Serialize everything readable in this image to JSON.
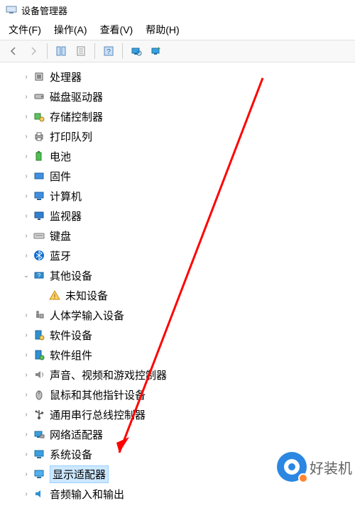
{
  "window": {
    "title": "设备管理器"
  },
  "menu": {
    "file": "文件(F)",
    "action": "操作(A)",
    "view": "查看(V)",
    "help": "帮助(H)"
  },
  "tree": {
    "items": [
      {
        "label": "处理器",
        "icon": "cpu",
        "expander": "›"
      },
      {
        "label": "磁盘驱动器",
        "icon": "disk",
        "expander": "›"
      },
      {
        "label": "存储控制器",
        "icon": "storage",
        "expander": "›"
      },
      {
        "label": "打印队列",
        "icon": "printer",
        "expander": "›"
      },
      {
        "label": "电池",
        "icon": "battery",
        "expander": "›"
      },
      {
        "label": "固件",
        "icon": "firmware",
        "expander": "›"
      },
      {
        "label": "计算机",
        "icon": "computer",
        "expander": "›"
      },
      {
        "label": "监视器",
        "icon": "monitor",
        "expander": "›"
      },
      {
        "label": "键盘",
        "icon": "keyboard",
        "expander": "›"
      },
      {
        "label": "蓝牙",
        "icon": "bluetooth",
        "expander": "›"
      },
      {
        "label": "其他设备",
        "icon": "other",
        "expander": "⌄",
        "children": [
          {
            "label": "未知设备",
            "icon": "unknown"
          }
        ]
      },
      {
        "label": "人体学输入设备",
        "icon": "hid",
        "expander": "›"
      },
      {
        "label": "软件设备",
        "icon": "software",
        "expander": "›"
      },
      {
        "label": "软件组件",
        "icon": "component",
        "expander": "›"
      },
      {
        "label": "声音、视频和游戏控制器",
        "icon": "sound",
        "expander": "›"
      },
      {
        "label": "鼠标和其他指针设备",
        "icon": "mouse",
        "expander": "›"
      },
      {
        "label": "通用串行总线控制器",
        "icon": "usb",
        "expander": "›"
      },
      {
        "label": "网络适配器",
        "icon": "network",
        "expander": "›"
      },
      {
        "label": "系统设备",
        "icon": "system",
        "expander": "›"
      },
      {
        "label": "显示适配器",
        "icon": "display",
        "expander": "›",
        "selected": true
      },
      {
        "label": "音频输入和输出",
        "icon": "audio",
        "expander": "›"
      }
    ]
  },
  "watermark": {
    "text": "好装机"
  }
}
